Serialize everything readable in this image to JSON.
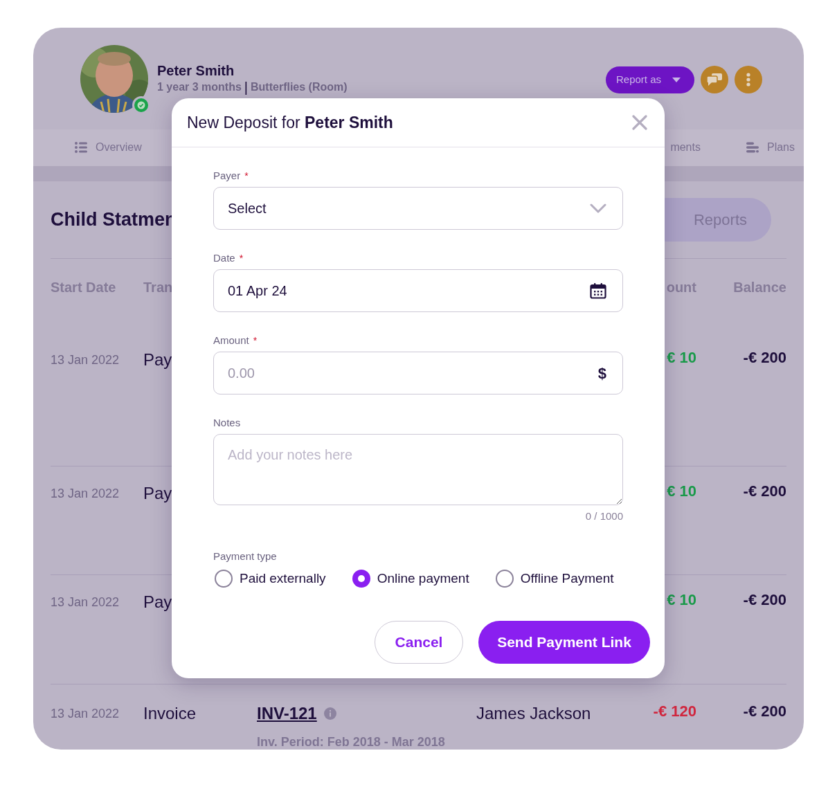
{
  "profile": {
    "name": "Peter Smith",
    "age": "1 year 3 months",
    "separator": "|",
    "room": "Butterflies (Room)",
    "online": true
  },
  "header_actions": {
    "report_button": "Report as"
  },
  "tabs": [
    {
      "label": "Overview",
      "selected": false
    },
    {
      "label": "ments",
      "selected": false
    },
    {
      "label": "Plans",
      "selected": false
    }
  ],
  "page_title": "Child Statmen",
  "reports_button": "Reports",
  "table": {
    "columns": [
      "Start Date",
      "Tran",
      "ount",
      "Balance"
    ],
    "rows": [
      {
        "kind": "payment",
        "start_date": "13 Jan 2022",
        "type": "Pay",
        "amount": "€ 10",
        "balance": "-€ 200"
      },
      {
        "kind": "payment",
        "start_date": "13 Jan 2022",
        "type": "Pay",
        "amount": "€ 10",
        "balance": "-€ 200"
      },
      {
        "kind": "payment",
        "start_date": "13 Jan 2022",
        "type": "Pay",
        "amount": "€ 10",
        "balance": "-€ 200"
      },
      {
        "kind": "invoice",
        "start_date": "13 Jan 2022",
        "type": "Invoice",
        "reference": "INV-121",
        "period": "Inv. Period: Feb 2018 - Mar 2018",
        "payer": "James Jackson",
        "amount": "-€ 120",
        "balance": "-€ 200"
      }
    ]
  },
  "modal": {
    "title": "New Deposit for **Peter Smith**",
    "fields": [
      {
        "kind": "select",
        "label": "Payer",
        "required_mark": "*",
        "value": "Select"
      },
      {
        "kind": "date",
        "label": "Date",
        "required_mark": "*",
        "value": "01 Apr 24"
      },
      {
        "kind": "amount",
        "label": "Amount",
        "required_mark": "*",
        "placeholder": "0.00",
        "suffix": "$"
      },
      {
        "kind": "textarea",
        "label": "Notes",
        "placeholder": "Add your notes here",
        "counter": "0 / 1000"
      }
    ],
    "payment_type": {
      "label": "Payment type",
      "options": [
        {
          "label": "Paid externally",
          "selected": false
        },
        {
          "label": "Online payment",
          "selected": true
        },
        {
          "label": "Offline Payment",
          "selected": false
        }
      ]
    },
    "buttons": {
      "cancel": "Cancel",
      "submit": "Send Payment Link"
    }
  }
}
